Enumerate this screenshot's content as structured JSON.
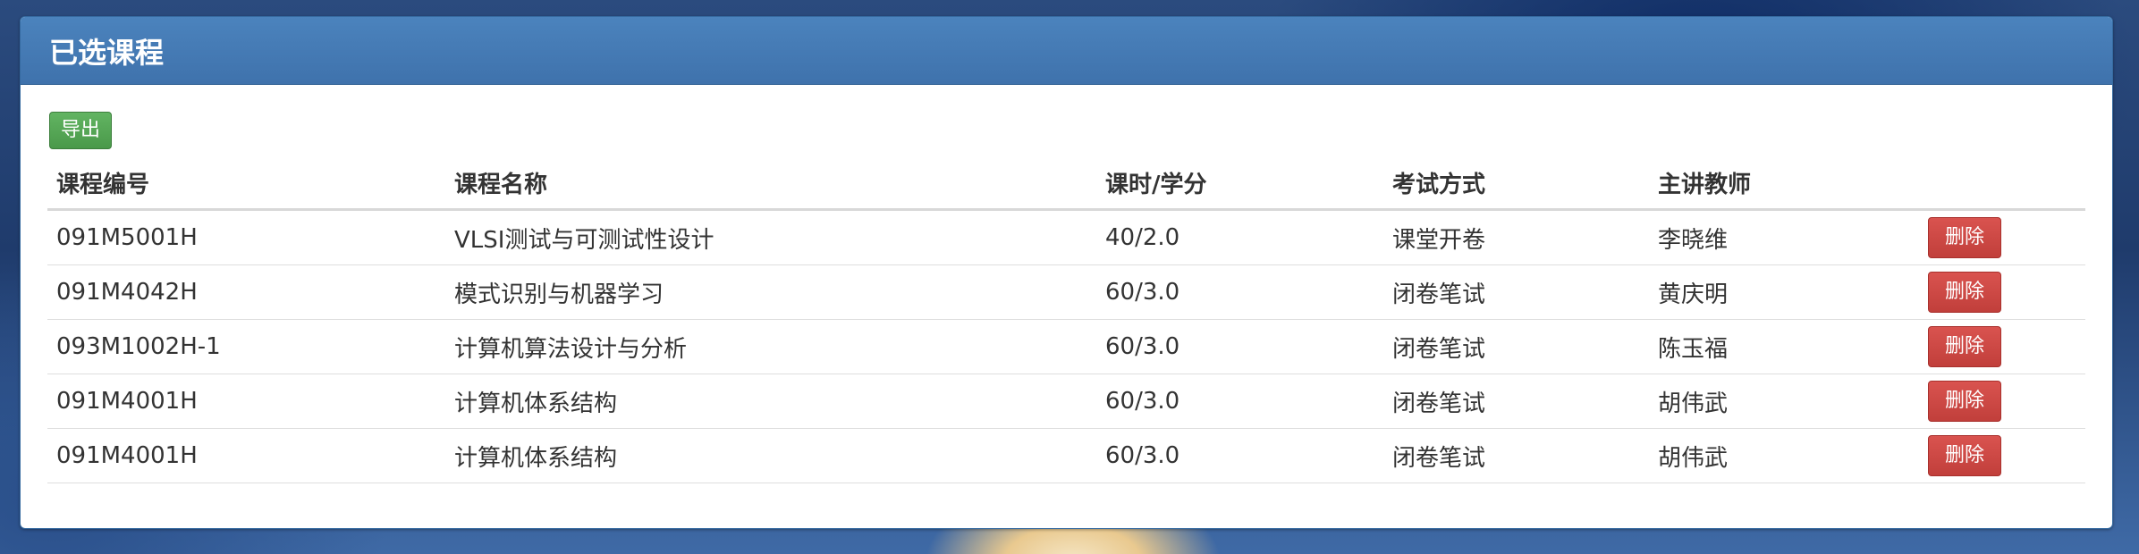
{
  "panel": {
    "title": "已选课程",
    "export_label": "导出"
  },
  "table": {
    "headers": [
      "课程编号",
      "课程名称",
      "课时/学分",
      "考试方式",
      "主讲教师",
      ""
    ],
    "rows": [
      {
        "code": "091M5001H",
        "name": "VLSI测试与可测试性设计",
        "hours": "40/2.0",
        "exam": "课堂开卷",
        "teacher": "李晓维",
        "action": "删除"
      },
      {
        "code": "091M4042H",
        "name": "模式识别与机器学习",
        "hours": "60/3.0",
        "exam": "闭卷笔试",
        "teacher": "黄庆明",
        "action": "删除"
      },
      {
        "code": "093M1002H-1",
        "name": "计算机算法设计与分析",
        "hours": "60/3.0",
        "exam": "闭卷笔试",
        "teacher": "陈玉福",
        "action": "删除"
      },
      {
        "code": "091M4001H",
        "name": "计算机体系结构",
        "hours": "60/3.0",
        "exam": "闭卷笔试",
        "teacher": "胡伟武",
        "action": "删除"
      },
      {
        "code": "091M4001H",
        "name": "计算机体系结构",
        "hours": "60/3.0",
        "exam": "闭卷笔试",
        "teacher": "胡伟武",
        "action": "删除"
      }
    ]
  },
  "colors": {
    "header_blue": "#4178b3",
    "export_green": "#5cb85c",
    "delete_red": "#d9534f"
  }
}
